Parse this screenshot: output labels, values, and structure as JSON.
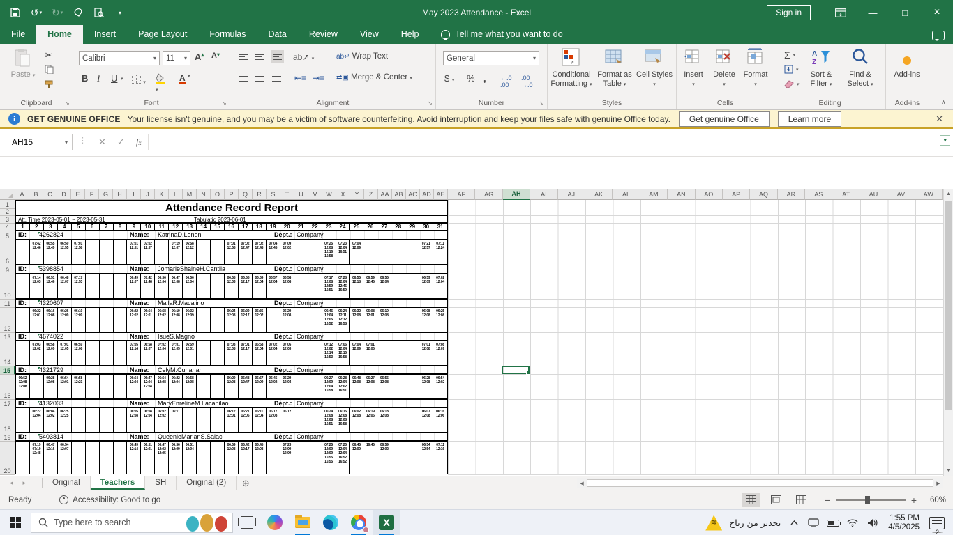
{
  "title_bar": {
    "title": "May 2023 Attendance  -  Excel",
    "sign_in": "Sign in"
  },
  "ribbon_tabs": [
    "File",
    "Home",
    "Insert",
    "Page Layout",
    "Formulas",
    "Data",
    "Review",
    "View",
    "Help"
  ],
  "active_tab": "Home",
  "tell_me": "Tell me what you want to do",
  "ribbon": {
    "paste": "Paste",
    "font_name": "Calibri",
    "font_size": "11",
    "wrap_text": "Wrap Text",
    "merge_center": "Merge & Center",
    "number_format": "General",
    "conditional": "Conditional Formatting",
    "format_table": "Format as Table",
    "cell_styles": "Cell Styles",
    "insert": "Insert",
    "delete": "Delete",
    "format": "Format",
    "sort_filter": "Sort & Filter",
    "find_select": "Find & Select",
    "addins": "Add-ins",
    "groups": {
      "clipboard": "Clipboard",
      "font": "Font",
      "alignment": "Alignment",
      "number": "Number",
      "styles": "Styles",
      "cells": "Cells",
      "editing": "Editing",
      "addins": "Add-ins"
    }
  },
  "warning_bar": {
    "label": "GET GENUINE OFFICE",
    "message": "Your license isn't genuine, and you may be a victim of software counterfeiting. Avoid interruption and keep your files safe with genuine Office today.",
    "get_button": "Get genuine Office",
    "learn_button": "Learn more"
  },
  "formula_bar": {
    "name_box": "AH15"
  },
  "grid": {
    "narrow_cols": [
      "A",
      "B",
      "C",
      "D",
      "E",
      "F",
      "G",
      "H",
      "I",
      "J",
      "K",
      "L",
      "M",
      "N",
      "O",
      "P",
      "Q",
      "R",
      "S",
      "T",
      "U",
      "V",
      "W",
      "X",
      "Y",
      "Z",
      "AA",
      "AB",
      "AC",
      "AD",
      "AE"
    ],
    "wide_cols": [
      "AF",
      "AG",
      "AH",
      "AI",
      "AJ",
      "AK",
      "AL",
      "AM",
      "AN",
      "AO",
      "AP",
      "AQ",
      "AR",
      "AS",
      "AT",
      "AU",
      "AV",
      "AW"
    ],
    "selected_col": "AH",
    "selected_row": "15",
    "row_numbers": [
      "1",
      "2",
      "3",
      "4",
      "5",
      "6",
      "9",
      "10",
      "11",
      "12",
      "13",
      "14",
      "15",
      "16",
      "17",
      "18",
      "19",
      "20"
    ]
  },
  "report": {
    "title": "Attendance Record Report",
    "att_time": "Att. Time 2023-05-01 ~ 2023-05-31",
    "tabulatic": "Tabulatic 2023-06-01",
    "days": [
      "1",
      "2",
      "3",
      "4",
      "5",
      "6",
      "7",
      "8",
      "9",
      "10",
      "11",
      "12",
      "13",
      "14",
      "15",
      "16",
      "17",
      "18",
      "19",
      "20",
      "21",
      "22",
      "23",
      "24",
      "25",
      "26",
      "27",
      "28",
      "29",
      "30",
      "31"
    ],
    "labels": {
      "id": "ID:",
      "name": "Name:",
      "dept": "Dept.:"
    },
    "records": [
      {
        "id": "4262824",
        "name": "KatrinaD.Lenon",
        "dept": "Company",
        "times": {
          "2": "07:42\n12:46",
          "3": "06:55\n12:49",
          "4": "06:50\n12:55",
          "5": "07:01\n12:58",
          "9": "07:01\n12:51",
          "10": "07:02\n12:57",
          "12": "07:19\n12:07",
          "13": "06:58\n12:12",
          "16": "07:01\n12:58",
          "17": "07:02\n12:47",
          "18": "07:02\n12:48",
          "19": "07:04\n12:45",
          "20": "07:09\n12:02",
          "23": "07:25\n12:08\n12:16\n16:58",
          "24": "07:23\n12:04\n16:51",
          "25": "07:04\n12:09",
          "30": "07:21\n12:57",
          "31": "07:11\n12:24"
        }
      },
      {
        "id": "5398854",
        "name": "JomarieShaineH.Cantila",
        "dept": "Company",
        "times": {
          "2": "07:14\n12:03",
          "3": "06:51\n12:46",
          "4": "06:48\n12:07",
          "5": "07:17\n12:53",
          "9": "06:49\n12:07",
          "10": "07:42\n12:48",
          "11": "06:56\n12:04",
          "12": "06:47\n12:08",
          "13": "06:56\n12:04",
          "16": "06:58\n12:03",
          "17": "06:55\n12:17",
          "18": "06:59\n12:04",
          "19": "06:57\n12:04",
          "20": "06:58\n12:08",
          "23": "07:17\n12:08\n12:59\n16:51",
          "24": "07:28\n12:04\n12:46\n16:59",
          "25": "06:55\n12:18",
          "26": "06:59\n12:45",
          "27": "06:55\n12:04",
          "30": "06:59\n12:09",
          "31": "07:02\n12:04"
        }
      },
      {
        "id": "4320607",
        "name": "MailaR.Macalino",
        "dept": "Company",
        "times": {
          "2": "06:22\n12:01",
          "3": "06:16\n12:08",
          "4": "06:26\n12:09",
          "5": "06:19\n12:09",
          "9": "06:22\n12:02",
          "10": "06:54\n12:01",
          "11": "06:58\n12:02",
          "12": "06:19\n12:08",
          "13": "06:32\n12:09",
          "16": "06:24\n12:08",
          "17": "06:29\n12:17",
          "18": "06:36\n12:02",
          "20": "06:29\n12:08",
          "23": "06:46\n12:04\n12:05\n16:52",
          "24": "06:24\n12:11\n12:12\n16:58",
          "25": "06:32\n12:08",
          "26": "06:08\n12:01",
          "27": "06:19\n12:08",
          "30": "06:08\n12:08",
          "31": "06:25\n12:08"
        }
      },
      {
        "id": "4674022",
        "name": "IsueS.Magno",
        "dept": "Company",
        "times": {
          "2": "07:03\n12:02",
          "3": "06:58\n12:09",
          "4": "07:01\n12:05",
          "5": "06:59\n12:08",
          "9": "07:05\n12:14",
          "10": "06:58\n12:07",
          "11": "07:02\n12:04",
          "12": "07:01\n12:05",
          "13": "06:59\n12:01",
          "16": "07:03\n12:08",
          "17": "07:01\n12:17",
          "18": "06:58\n12:04",
          "19": "07:02\n12:04",
          "20": "07:05\n12:03",
          "23": "07:12\n12:02\n12:14\n16:53",
          "24": "07:06\n12:04\n12:15\n16:58",
          "25": "07:04\n12:09",
          "26": "07:01\n12:05",
          "30": "07:01\n12:08",
          "31": "07:08\n12:09"
        }
      },
      {
        "id": "4321729",
        "name": "CelyM.Cunanan",
        "dept": "Company",
        "times": {
          "1": "06:52\n12:08\n12:08",
          "3": "06:28\n12:08",
          "4": "06:54\n12:01",
          "5": "06:58\n12:21",
          "9": "06:54\n12:04",
          "10": "06:47\n12:04\n12:04",
          "11": "06:54\n12:08",
          "12": "06:22\n12:04",
          "13": "06:58\n12:08",
          "16": "06:29\n12:08",
          "17": "06:48\n12:47",
          "18": "06:57\n12:09",
          "19": "06:45\n12:02",
          "20": "06:29\n12:04",
          "23": "06:27\n12:09\n12:04\n16:58",
          "24": "06:28\n12:04\n12:02\n16:51",
          "25": "06:48\n12:08",
          "26": "06:27\n12:08",
          "27": "06:55\n12:08",
          "30": "06:28\n12:08",
          "31": "06:54\n12:02"
        }
      },
      {
        "id": "4132033",
        "name": "MaryEnrelineM.Lacanilao",
        "dept": "Company",
        "times": {
          "2": "06:22\n12:04",
          "3": "06:04\n12:02",
          "4": "06:25\n12:25",
          "9": "06:05\n12:08",
          "10": "06:08\n12:04",
          "11": "06:02\n12:02",
          "12": "06:11",
          "16": "06:12\n12:01",
          "17": "06:21\n12:05",
          "18": "06:11\n12:04",
          "19": "06:17\n12:08",
          "20": "06:12",
          "23": "06:24\n12:08\n12:08\n16:51",
          "24": "06:15\n12:08\n12:08\n16:58",
          "25": "06:02\n12:08",
          "26": "06:19\n12:05",
          "27": "06:18\n12:08",
          "30": "06:07\n12:08",
          "31": "06:16\n12:06"
        }
      },
      {
        "id": "5403814",
        "name": "QueenieMarianS.Salac",
        "dept": "Company",
        "times": {
          "2": "07:19\n07:19\n12:48",
          "3": "06:47\n12:16",
          "4": "06:54\n12:07",
          "9": "06:49\n12:14",
          "10": "06:51\n12:01",
          "11": "06:47\n12:02\n12:05",
          "12": "06:56\n12:09",
          "13": "06:51\n12:04",
          "16": "06:59\n12:08",
          "17": "06:42\n12:17",
          "18": "06:45\n12:08",
          "20": "07:23\n12:09\n12:09",
          "23": "07:25\n12:09\n12:09\n16:55\n16:55",
          "24": "07:25\n12:04\n12:04\n16:52\n16:52",
          "25": "06:45\n12:09",
          "26": "16:46",
          "27": "06:59\n12:02",
          "30": "06:54\n12:54",
          "31": "07:11\n12:16"
        }
      }
    ]
  },
  "sheet_tabs": {
    "tabs": [
      "Original",
      "Teachers",
      "SH",
      "Original (2)"
    ],
    "active": "Teachers"
  },
  "status_bar": {
    "ready": "Ready",
    "accessibility": "Accessibility: Good to go",
    "zoom": "60%"
  },
  "taskbar": {
    "search_placeholder": "Type here to search",
    "tray_alert": "تحذير من رياح",
    "time": "1:55 PM",
    "date": "4/5/2025",
    "notification_count": "2"
  },
  "colors": {
    "excel_green": "#217346",
    "warning_bg": "#fcf4d1",
    "taskbar_underline": "#0078d7"
  }
}
